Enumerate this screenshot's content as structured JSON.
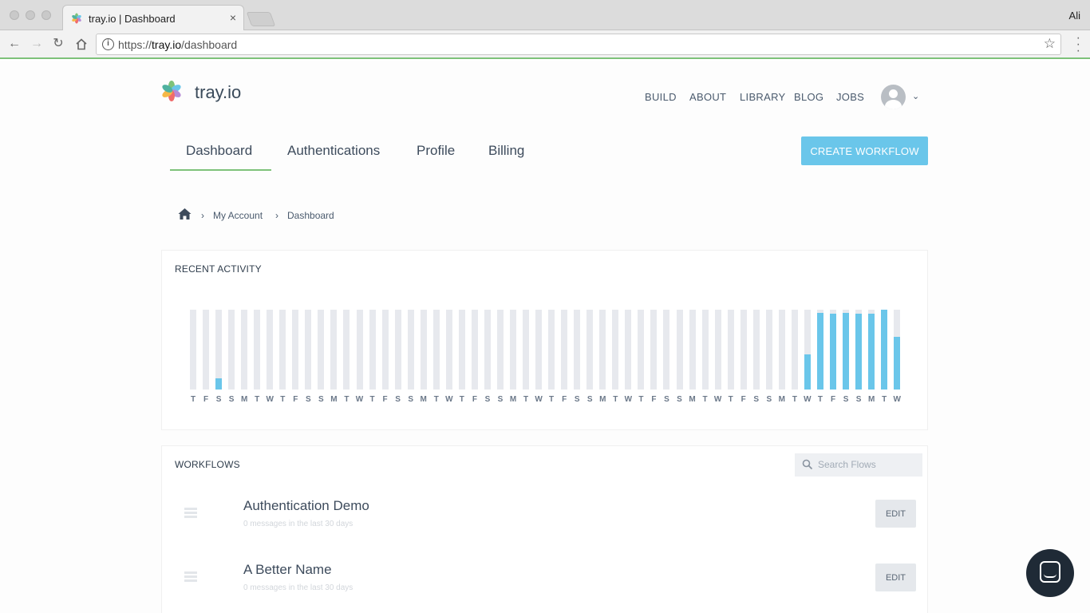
{
  "browser": {
    "tab_title": "tray.io | Dashboard",
    "tab_close": "×",
    "user": "Ali",
    "url_prefix": "https://",
    "url_host": "tray.io",
    "url_path": "/dashboard"
  },
  "header": {
    "brand": "tray.io",
    "nav": [
      {
        "label": "BUILD"
      },
      {
        "label": "ABOUT"
      },
      {
        "label": "LIBRARY"
      },
      {
        "label": "BLOG"
      },
      {
        "label": "JOBS"
      }
    ]
  },
  "subnav": {
    "tabs": [
      {
        "label": "Dashboard",
        "active": true
      },
      {
        "label": "Authentications"
      },
      {
        "label": "Profile"
      },
      {
        "label": "Billing"
      }
    ],
    "create_label": "CREATE WORKFLOW"
  },
  "breadcrumb": {
    "separator": "›",
    "items": [
      "My Account",
      "Dashboard"
    ]
  },
  "recent_activity": {
    "title": "RECENT ACTIVITY",
    "days": [
      "T",
      "F",
      "S",
      "S",
      "M",
      "T",
      "W",
      "T",
      "F",
      "S",
      "S",
      "M",
      "T",
      "W",
      "T",
      "F",
      "S",
      "S",
      "M",
      "T",
      "W",
      "T",
      "F",
      "S",
      "S",
      "M",
      "T",
      "W",
      "T",
      "F",
      "S",
      "S",
      "M",
      "T",
      "W",
      "T",
      "F",
      "S",
      "S",
      "M",
      "T",
      "W",
      "T",
      "F",
      "S",
      "S",
      "M",
      "T",
      "W",
      "T",
      "F",
      "S",
      "S",
      "M",
      "T",
      "W"
    ],
    "levels": [
      0,
      0,
      0.14,
      0,
      0,
      0,
      0,
      0,
      0,
      0,
      0,
      0,
      0,
      0,
      0,
      0,
      0,
      0,
      0,
      0,
      0,
      0,
      0,
      0,
      0,
      0,
      0,
      0,
      0,
      0,
      0,
      0,
      0,
      0,
      0,
      0,
      0,
      0,
      0,
      0,
      0,
      0,
      0,
      0,
      0,
      0,
      0,
      0,
      0.44,
      0.96,
      0.95,
      0.96,
      0.95,
      0.95,
      1.0,
      0.66
    ]
  },
  "workflows": {
    "title": "WORKFLOWS",
    "search_placeholder": "Search Flows",
    "edit_label": "EDIT",
    "items": [
      {
        "name": "Authentication Demo",
        "subtitle": "0 messages in the last 30 days"
      },
      {
        "name": "A Better Name",
        "subtitle": "0 messages in the last 30 days"
      }
    ]
  },
  "colors": {
    "accent": "#6ac6ea",
    "active_underline": "#7ec27a",
    "bar_track": "#e7e9ee"
  }
}
